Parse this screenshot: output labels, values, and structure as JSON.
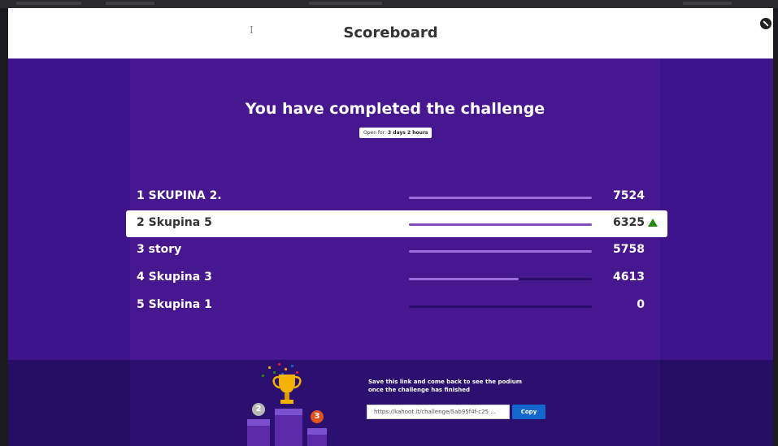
{
  "header": {
    "title": "Scoreboard",
    "cursor_glyph": "I",
    "close_icon": "close-circle-icon"
  },
  "challenge": {
    "heading": "You have completed the challenge",
    "open_label": "Open for: ",
    "open_value": "3 days 2 hours"
  },
  "scoreboard": [
    {
      "rank": "1",
      "name": "SKUPINA 2.",
      "label": "1 SKUPINA 2.",
      "score": "7524",
      "progress": 1.0,
      "highlighted": false
    },
    {
      "rank": "2",
      "name": "Skupina 5",
      "label": "2 Skupina 5",
      "score": "6325",
      "progress": 1.0,
      "highlighted": true,
      "trend": "up-arrow-icon"
    },
    {
      "rank": "3",
      "name": "story",
      "label": "3 story",
      "score": "5758",
      "progress": 1.0,
      "highlighted": false
    },
    {
      "rank": "4",
      "name": "Skupina 3",
      "label": "4 Skupina 3",
      "score": "4613",
      "progress": 0.6,
      "highlighted": false
    },
    {
      "rank": "5",
      "name": "Skupina 1",
      "label": "5 Skupina 1",
      "score": "0",
      "progress": 0.0,
      "highlighted": false
    }
  ],
  "footer": {
    "save_message_line1": "Save this link and come back to see the podium",
    "save_message_line2": "once the challenge has finished",
    "link_value": "https://kahoot.it/challenge/5ab95f4f-c25 ...",
    "copy_label": "Copy",
    "silver_medal": "2",
    "bronze_medal": "3"
  },
  "colors": {
    "purple_main": "#46178f",
    "purple_footer": "#2b1070",
    "trend_green": "#26890c",
    "copy_blue": "#1368ce",
    "trophy_gold": "#f2b300"
  }
}
